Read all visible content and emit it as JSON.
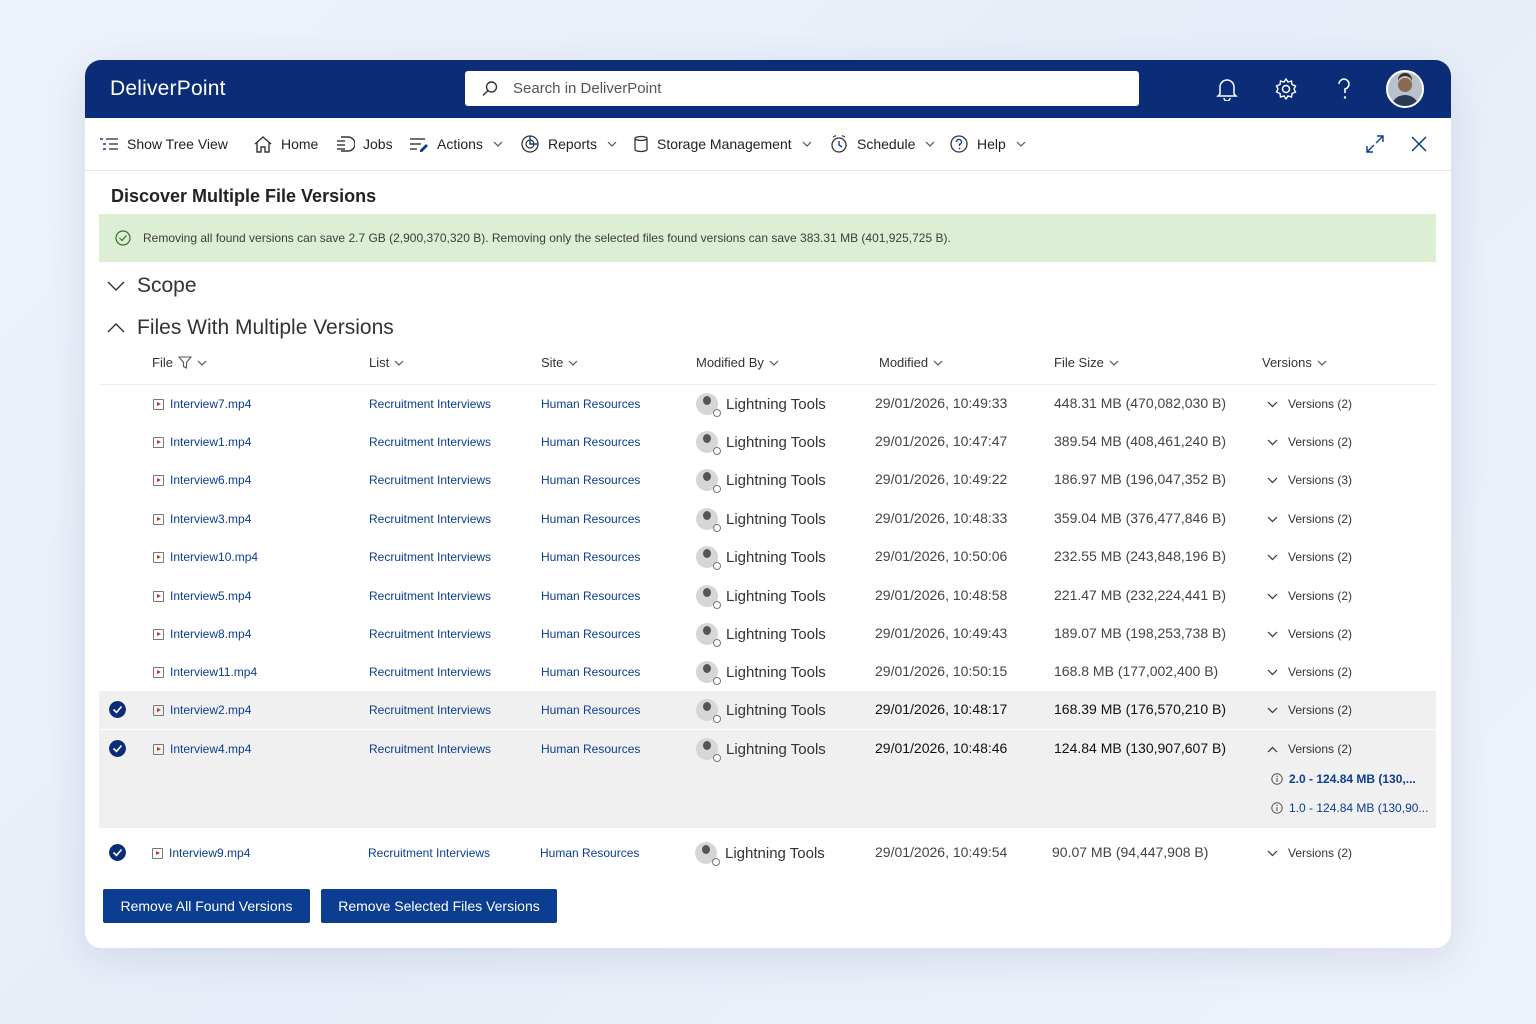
{
  "app": {
    "title": "DeliverPoint",
    "search_placeholder": "Search in DeliverPoint"
  },
  "toolbar": {
    "items": [
      {
        "label": "Show Tree View",
        "icon": "tree-view-icon"
      },
      {
        "label": "Home",
        "icon": "home-icon"
      },
      {
        "label": "Jobs",
        "icon": "jobs-icon"
      },
      {
        "label": "Actions",
        "icon": "actions-icon"
      },
      {
        "label": "Reports",
        "icon": "reports-icon"
      },
      {
        "label": "Storage Management",
        "icon": "storage-icon"
      },
      {
        "label": "Schedule",
        "icon": "schedule-icon"
      },
      {
        "label": "Help",
        "icon": "help-icon"
      }
    ]
  },
  "page": {
    "title": "Discover Multiple File Versions",
    "banner": "Removing all found versions can save 2.7 GB (2,900,370,320 B). Removing only the selected files found versions can save 383.31 MB (401,925,725 B).",
    "scope_label": "Scope",
    "files_label": "Files With Multiple Versions"
  },
  "table": {
    "columns": [
      "File",
      "List",
      "Site",
      "Modified By",
      "Modified",
      "File Size",
      "Versions"
    ],
    "rows": [
      {
        "file": "Interview7.mp4",
        "list": "Recruitment Interviews",
        "site": "Human Resources",
        "modified_by": "Lightning Tools",
        "modified": "29/01/2026, 10:49:33",
        "size": "448.31 MB (470,082,030 B)",
        "versions": "Versions (2)",
        "selected": false
      },
      {
        "file": "Interview1.mp4",
        "list": "Recruitment Interviews",
        "site": "Human Resources",
        "modified_by": "Lightning Tools",
        "modified": "29/01/2026, 10:47:47",
        "size": "389.54 MB (408,461,240 B)",
        "versions": "Versions (2)",
        "selected": false
      },
      {
        "file": "Interview6.mp4",
        "list": "Recruitment Interviews",
        "site": "Human Resources",
        "modified_by": "Lightning Tools",
        "modified": "29/01/2026, 10:49:22",
        "size": "186.97 MB (196,047,352 B)",
        "versions": "Versions (3)",
        "selected": false
      },
      {
        "file": "Interview3.mp4",
        "list": "Recruitment Interviews",
        "site": "Human Resources",
        "modified_by": "Lightning Tools",
        "modified": "29/01/2026, 10:48:33",
        "size": "359.04 MB (376,477,846 B)",
        "versions": "Versions (2)",
        "selected": false
      },
      {
        "file": "Interview10.mp4",
        "list": "Recruitment Interviews",
        "site": "Human Resources",
        "modified_by": "Lightning Tools",
        "modified": "29/01/2026, 10:50:06",
        "size": "232.55 MB (243,848,196 B)",
        "versions": "Versions (2)",
        "selected": false
      },
      {
        "file": "Interview5.mp4",
        "list": "Recruitment Interviews",
        "site": "Human Resources",
        "modified_by": "Lightning Tools",
        "modified": "29/01/2026, 10:48:58",
        "size": "221.47 MB (232,224,441 B)",
        "versions": "Versions (2)",
        "selected": false
      },
      {
        "file": "Interview8.mp4",
        "list": "Recruitment Interviews",
        "site": "Human Resources",
        "modified_by": "Lightning Tools",
        "modified": "29/01/2026, 10:49:43",
        "size": "189.07 MB (198,253,738 B)",
        "versions": "Versions (2)",
        "selected": false
      },
      {
        "file": "Interview11.mp4",
        "list": "Recruitment Interviews",
        "site": "Human Resources",
        "modified_by": "Lightning Tools",
        "modified": "29/01/2026, 10:50:15",
        "size": "168.8 MB (177,002,400 B)",
        "versions": "Versions (2)",
        "selected": false
      },
      {
        "file": "Interview2.mp4",
        "list": "Recruitment Interviews",
        "site": "Human Resources",
        "modified_by": "Lightning Tools",
        "modified": "29/01/2026, 10:48:17",
        "size": "168.39 MB (176,570,210 B)",
        "versions": "Versions (2)",
        "selected": true
      },
      {
        "file": "Interview4.mp4",
        "list": "Recruitment Interviews",
        "site": "Human Resources",
        "modified_by": "Lightning Tools",
        "modified": "29/01/2026, 10:48:46",
        "size": "124.84 MB (130,907,607 B)",
        "versions": "Versions (2)",
        "selected": true
      },
      {
        "file": "Interview9.mp4",
        "list": "Recruitment Interviews",
        "site": "Human Resources",
        "modified_by": "Lightning Tools",
        "modified": "29/01/2026, 10:49:54",
        "size": "90.07 MB (94,447,908 B)",
        "versions": "Versions (2)",
        "selected": true
      }
    ],
    "expanded_versions": [
      "2.0 - 124.84 MB (130,...",
      "1.0 - 124.84 MB (130,90..."
    ]
  },
  "buttons": {
    "remove_all": "Remove All Found Versions",
    "remove_selected": "Remove Selected Files Versions"
  },
  "colors": {
    "brand": "#0b2d78",
    "banner": "#dcefd4",
    "link": "#0b3d91"
  }
}
